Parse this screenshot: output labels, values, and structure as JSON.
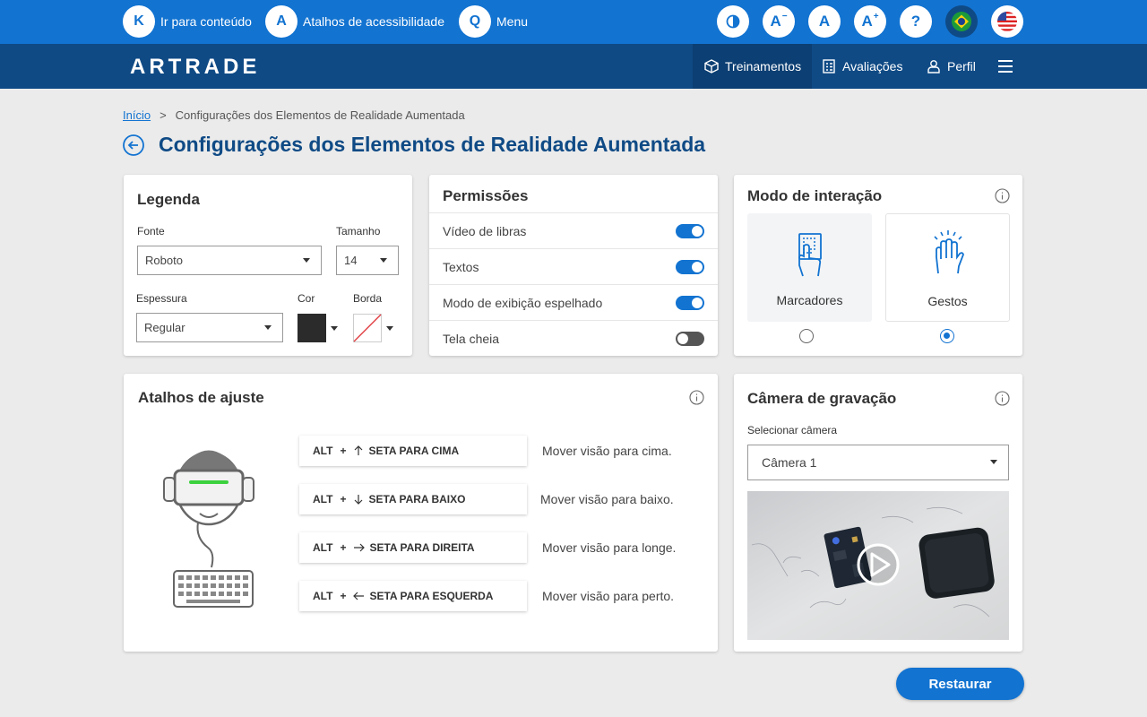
{
  "accessibility_bar": {
    "skip_links": [
      {
        "key": "K",
        "label": "Ir para conteúdo"
      },
      {
        "key": "A",
        "label": "Atalhos de acessibilidade"
      },
      {
        "key": "Q",
        "label": "Menu"
      }
    ],
    "tools": {
      "font_decrease": "A",
      "font_reset": "A",
      "font_increase": "A",
      "help": "?"
    },
    "languages": [
      "pt-BR flag",
      "en-US flag"
    ]
  },
  "header": {
    "logo": "ARTRADE",
    "nav": {
      "training": "Treinamentos",
      "assessments": "Avaliações",
      "profile": "Perfil"
    }
  },
  "breadcrumb": {
    "home": "Início",
    "separator": ">",
    "current": "Configurações dos Elementos de Realidade Aumentada"
  },
  "page_title": "Configurações dos Elementos de Realidade Aumentada",
  "legend": {
    "title": "Legenda",
    "font_label": "Fonte",
    "font_value": "Roboto",
    "size_label": "Tamanho",
    "size_value": "14",
    "weight_label": "Espessura",
    "weight_value": "Regular",
    "color_label": "Cor",
    "color_value": "#2b2b2b",
    "border_label": "Borda"
  },
  "permissions": {
    "title": "Permissões",
    "items": [
      {
        "label": "Vídeo de libras",
        "enabled": true
      },
      {
        "label": "Textos",
        "enabled": true
      },
      {
        "label": "Modo de exibição espelhado",
        "enabled": true
      },
      {
        "label": "Tela cheia",
        "enabled": false
      }
    ]
  },
  "interaction_mode": {
    "title": "Modo de interação",
    "options": [
      {
        "label": "Marcadores",
        "selected": false
      },
      {
        "label": "Gestos",
        "selected": true
      }
    ]
  },
  "shortcuts": {
    "title": "Atalhos de ajuste",
    "items": [
      {
        "modifier": "ALT",
        "plus": "+",
        "arrow": "up-arrow-icon",
        "key": "SETA PARA CIMA",
        "description": "Mover visão para cima."
      },
      {
        "modifier": "ALT",
        "plus": "+",
        "arrow": "down-arrow-icon",
        "key": "SETA PARA BAIXO",
        "description": "Mover visão para baixo."
      },
      {
        "modifier": "ALT",
        "plus": "+",
        "arrow": "right-arrow-icon",
        "key": "SETA PARA DIREITA",
        "description": "Mover visão para longe."
      },
      {
        "modifier": "ALT",
        "plus": "+",
        "arrow": "left-arrow-icon",
        "key": "SETA PARA ESQUERDA",
        "description": "Mover visão para perto."
      }
    ]
  },
  "camera": {
    "title": "Câmera de gravação",
    "select_label": "Selecionar câmera",
    "selected_camera": "Câmera 1"
  },
  "actions": {
    "restore": "Restaurar"
  },
  "colors": {
    "primary": "#1273d1",
    "navbar": "#0f4a85",
    "title": "#0f4a85"
  }
}
